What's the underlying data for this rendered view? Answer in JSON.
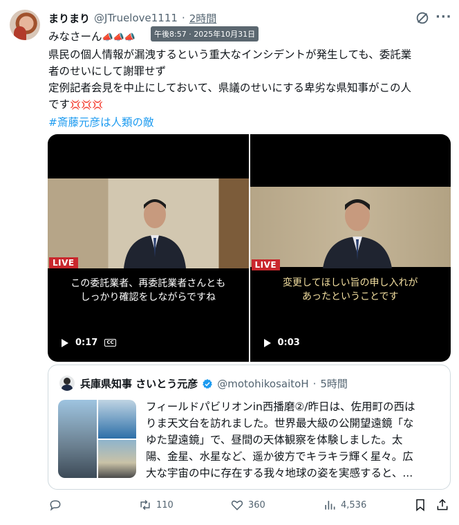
{
  "post": {
    "author_name": "まりまり",
    "handle": "@JTruelove1111",
    "separator": "·",
    "time_ago": "2時間",
    "timestamp_tooltip": "午後8:57 · 2025年10月31日",
    "text_line1": "みなさーん",
    "text_line1_emoji": "📣📣📣",
    "text_line2": "県民の個人情報が漏洩するという重大なインシデントが発生しても、委託業",
    "text_line3": "者のせいにして謝罪せず",
    "text_line4": "定例記者会見を中止にしておいて、県議のせいにする卑劣な県知事がこの人",
    "text_line5": "です",
    "text_line5_emoji": "💢💢💢",
    "hashtag": "#斎藤元彦は人類の敵"
  },
  "videos": [
    {
      "live_label": "LIVE",
      "subtitle_line1": "この委託業者、再委託業者さんとも",
      "subtitle_line2": "しっかり確認をしながらですね",
      "duration": "0:17",
      "cc_label": "CC"
    },
    {
      "live_label": "LIVE",
      "subtitle_line1": "変更してほしい旨の申し入れが",
      "subtitle_line2": "あったということです",
      "duration": "0:03"
    }
  ],
  "quote": {
    "author_name": "兵庫県知事 さいとう元彦",
    "handle": "@motohikosaitoH",
    "separator": "·",
    "time_ago": "5時間",
    "text_line1": "フィールドパビリオンin西播磨②/昨日は、佐用町の西は",
    "text_line2": "りま天文台を訪れました。世界最大級の公開望遠鏡「な",
    "text_line3": "ゆた望遠鏡」で、昼間の天体観察を体験しました。太",
    "text_line4": "陽、金星、水星など、遥か彼方でキラキラ輝く星々。広",
    "text_line5": "大な宇宙の中に存在する我々地球の姿を実感すると、..."
  },
  "actions": {
    "reposts": "110",
    "likes": "360",
    "views": "4,536"
  },
  "icons": [
    "reply-icon",
    "repost-icon",
    "like-icon",
    "views-icon",
    "bookmark-icon",
    "share-icon",
    "grok-icon",
    "more-icon",
    "verified-icon",
    "play-icon"
  ],
  "colors": {
    "accent": "#1d9bf0",
    "muted": "#536471",
    "live": "#c9272d",
    "verified": "#1d9bf0"
  }
}
